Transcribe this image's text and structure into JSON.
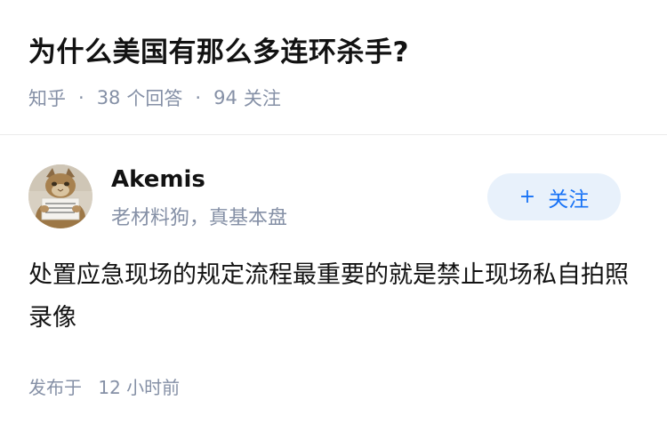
{
  "question": {
    "title": "为什么美国有那么多连环杀手?",
    "meta": {
      "source": "知乎",
      "answers_count": "38",
      "answers_label": "个回答",
      "follows_count": "94",
      "follows_label": "关注"
    }
  },
  "answer": {
    "author": {
      "name": "Akemis",
      "bio": "老材料狗，真基本盘",
      "avatar_icon": "cat-holding-sign-avatar"
    },
    "follow_button": {
      "icon": "+",
      "label": "关注"
    },
    "content": "处置应急现场的规定流程最重要的就是禁止现场私自拍照录像",
    "published": {
      "label": "发布于",
      "time": "12 小时前"
    }
  },
  "colors": {
    "title_text": "#121212",
    "secondary_text": "#8590a6",
    "follow_button_bg": "#e8f1fb",
    "follow_button_text": "#1772f6",
    "divider": "#ebebeb"
  }
}
